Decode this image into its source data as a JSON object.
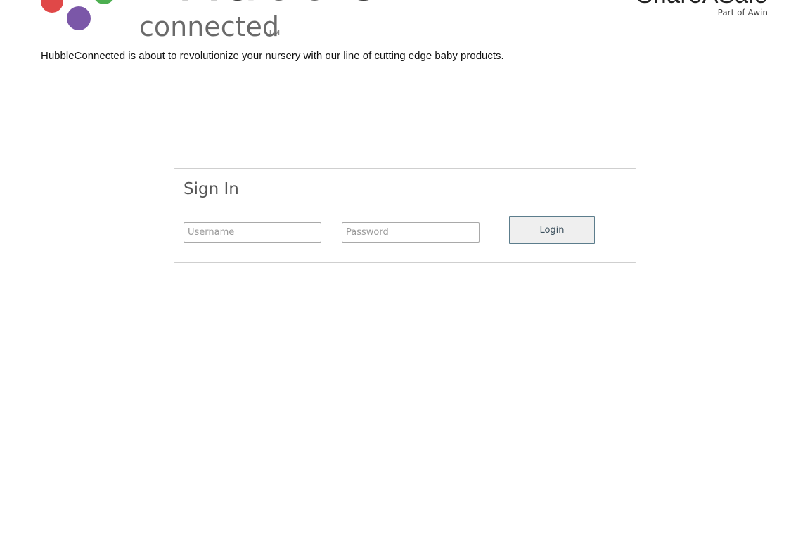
{
  "header": {
    "brand": {
      "wordmark": "Hubble",
      "subtitle": "connected",
      "trademark": "TM",
      "dot_colors": [
        "#e04848",
        "#4caf50",
        "#7b57a8"
      ]
    },
    "partner": {
      "name": "ShareASale",
      "tagline": "Part of Awin"
    }
  },
  "tagline": "HubbleConnected is about to revolutionize your nursery with our line of cutting edge baby products.",
  "signin": {
    "title": "Sign In",
    "username": {
      "value": "",
      "placeholder": "Username"
    },
    "password": {
      "value": "",
      "placeholder": "Password"
    },
    "login_label": "Login"
  }
}
